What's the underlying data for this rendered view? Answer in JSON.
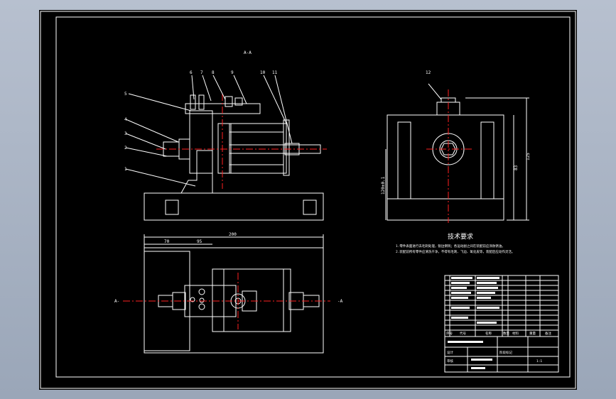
{
  "section_label": "A-A",
  "part_numbers": [
    "1",
    "2",
    "3",
    "4",
    "5",
    "6",
    "7",
    "8",
    "9",
    "10",
    "11",
    "12"
  ],
  "dimensions": {
    "top_overall": "200",
    "top_left": "70",
    "top_mid": "95",
    "side_height": "125",
    "side_center": "120±0.1"
  },
  "view_markers": {
    "left": "A-",
    "right": "-A"
  },
  "tech_title": "技术要求",
  "tech_notes": [
    "1.零件表面进行去毛刺处理，锐边倒钝；各运动副之间在装配前应涂防锈油。",
    "2.装配前所有零件应清洗干净，不得有毛刺、飞边、氧化皮等，装配后应动作灵活。"
  ],
  "title_block": {
    "col_headers": [
      "序号",
      "代号",
      "名称",
      "数量",
      "材料",
      "重量",
      "备注"
    ],
    "designer_label": "设计",
    "approve_label": "审核",
    "stage_label": "阶段标记",
    "scale": "1:1"
  },
  "colors": {
    "paper": "#000000",
    "line": "#ffffff",
    "hatch": "#ffffff",
    "center": "#ff2020",
    "background": "#a9b3c3"
  }
}
